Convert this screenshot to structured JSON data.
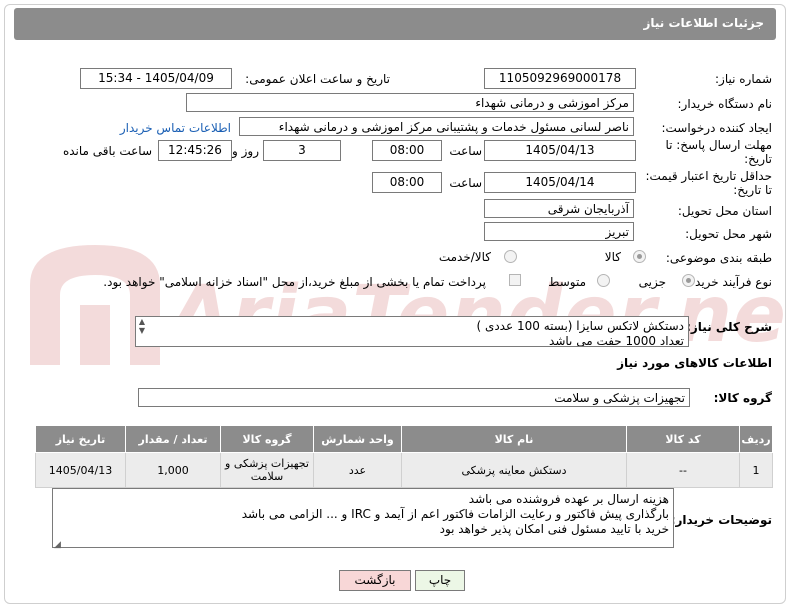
{
  "header": {
    "title": "جزئیات اطلاعات نیاز"
  },
  "need_number": {
    "label": "شماره نیاز:",
    "value": "1105092969000178"
  },
  "announce_datetime": {
    "label": "تاریخ و ساعت اعلان عمومی:",
    "value": "1405/04/09 - 15:34"
  },
  "buyer_org": {
    "label": "نام دستگاه خریدار:",
    "value": "مرکز اموزشی و درمانی شهداء"
  },
  "requester": {
    "label": "ایجاد کننده درخواست:",
    "value": "ناصر لسانی مسئول خدمات و پشتیبانی مرکز اموزشی و درمانی شهداء",
    "contact_link": "اطلاعات تماس خریدار"
  },
  "reply_deadline": {
    "label_line1": "مهلت ارسال پاسخ: تا",
    "label_line2": "تاریخ:",
    "date": "1405/04/13",
    "time_label": "ساعت",
    "time": "08:00",
    "days": "3",
    "days_label": "روز و",
    "remaining": "12:45:26",
    "remaining_label": "ساعت باقی مانده"
  },
  "price_validity": {
    "label_line1": "حداقل تاریخ اعتبار قیمت:",
    "label_line2": "تا تاریخ:",
    "date": "1405/04/14",
    "time_label": "ساعت",
    "time": "08:00"
  },
  "delivery_province": {
    "label": "استان محل تحویل:",
    "value": "آذربایجان شرقی"
  },
  "delivery_city": {
    "label": "شهر محل تحویل:",
    "value": "تبریز"
  },
  "category": {
    "label": "طبقه بندی موضوعی:",
    "options": [
      "کالا",
      "کالا/خدمت"
    ]
  },
  "process_type": {
    "label": "نوع فرآیند خرید :",
    "options": [
      "جزیی",
      "متوسط"
    ],
    "payment_note": "پرداخت تمام یا بخشی از مبلغ خرید،از محل \"اسناد خزانه اسلامی\" خواهد بود."
  },
  "need_description": {
    "label": "شرح کلی نیاز:",
    "lines": [
      "دستکش لاتکس سایزl (بسته 100 عددی )",
      "تعداد 1000 جفت می باشد"
    ]
  },
  "goods_info": {
    "title": "اطلاعات کالاهای مورد نیاز"
  },
  "goods_group": {
    "label": "گروه کالا:",
    "value": "تجهیزات پزشکی و سلامت"
  },
  "table": {
    "headers": [
      "ردیف",
      "کد کالا",
      "نام کالا",
      "واحد شمارش",
      "گروه کالا",
      "تعداد / مقدار",
      "تاریخ نیاز"
    ],
    "rows": [
      [
        "1",
        "--",
        "دستکش معاینه پزشکی",
        "عدد",
        "تجهیزات پزشکی و سلامت",
        "1,000",
        "1405/04/13"
      ]
    ]
  },
  "buyer_notes": {
    "label": "توضیحات خریدار:",
    "lines": [
      "هزینه ارسال بر عهده فروشنده می باشد",
      "بارگذاری پیش فاکتور و رعایت الزامات فاکتور اعم از آیمد و IRC  و ... الزامی می باشد",
      "خرید با تایید مسئول فنی امکان پذیر خواهد بود"
    ]
  },
  "buttons": {
    "print": "چاپ",
    "back": "بازگشت"
  },
  "watermark": {
    "text": "AriaTender.net"
  },
  "colors": {
    "header_bg": "#8c8c8c",
    "link": "#1a5fb4",
    "back_button_bg": "#f8d7d7",
    "print_button_bg": "#ecf7e6"
  }
}
